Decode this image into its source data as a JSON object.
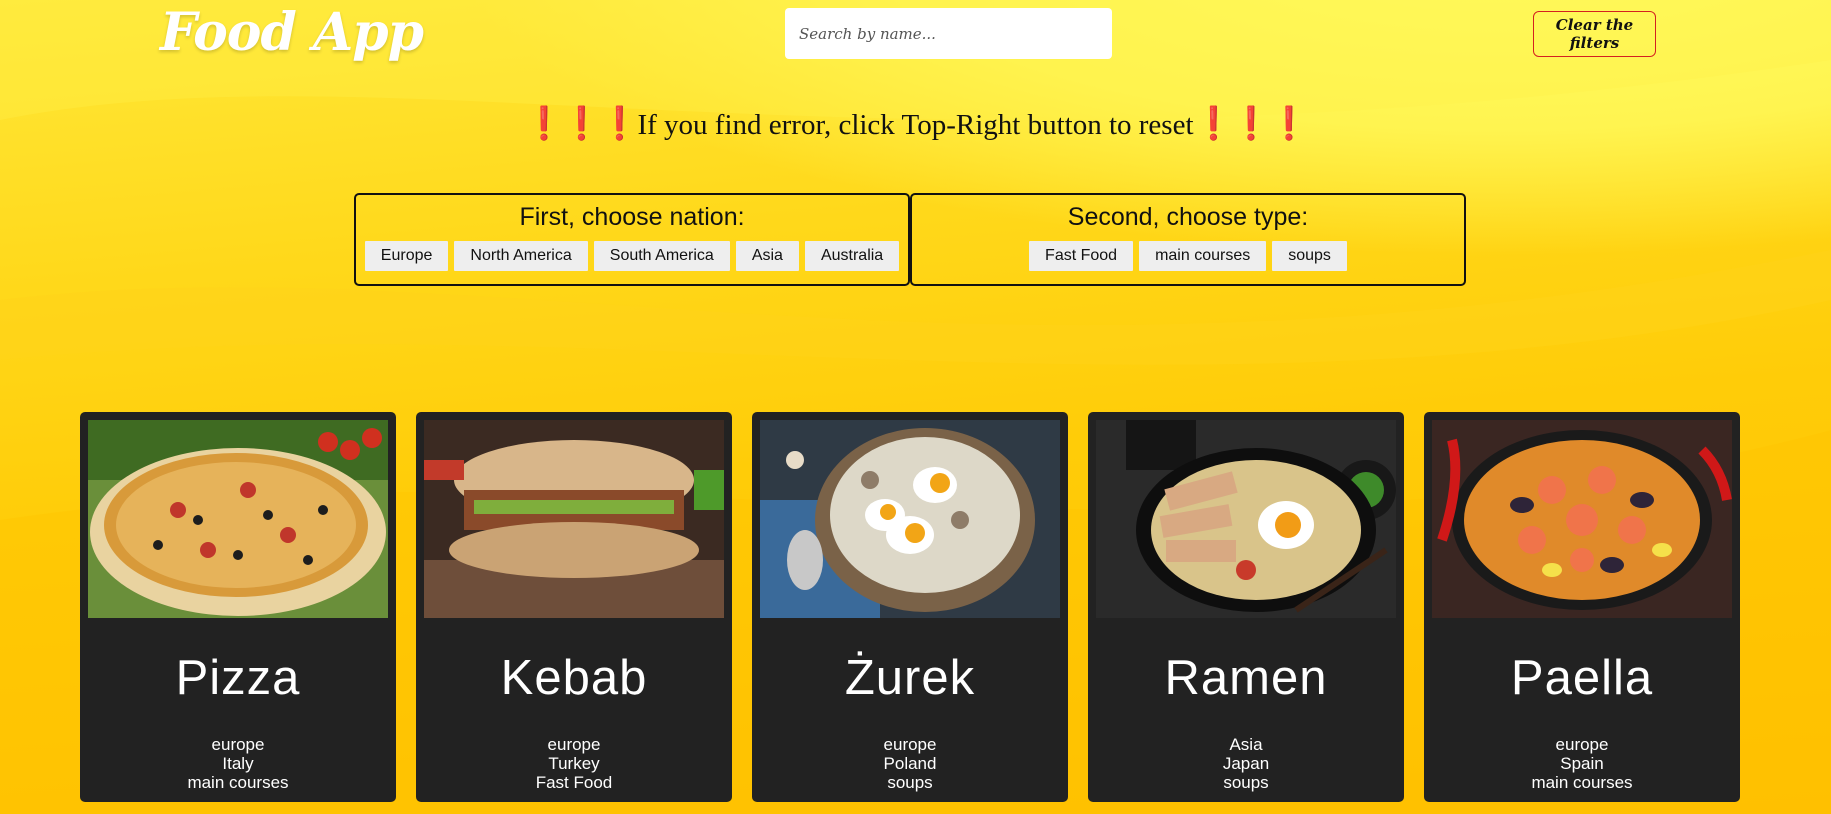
{
  "header": {
    "logo": "Food App",
    "search_placeholder": "Search by name...",
    "clear_label": "Clear the filters"
  },
  "warning": {
    "icon": "❗❗❗",
    "text": "If you find error, click Top-Right button to reset"
  },
  "filters": {
    "nation": {
      "title": "First, choose nation:",
      "options": [
        "Europe",
        "North America",
        "South America",
        "Asia",
        "Australia"
      ]
    },
    "type": {
      "title": "Second, choose type:",
      "options": [
        "Fast Food",
        "main courses",
        "soups"
      ]
    }
  },
  "dishes": [
    {
      "name": "Pizza",
      "region": "europe",
      "country": "Italy",
      "type": "main courses"
    },
    {
      "name": "Kebab",
      "region": "europe",
      "country": "Turkey",
      "type": "Fast Food"
    },
    {
      "name": "Żurek",
      "region": "europe",
      "country": "Poland",
      "type": "soups"
    },
    {
      "name": "Ramen",
      "region": "Asia",
      "country": "Japan",
      "type": "soups"
    },
    {
      "name": "Paella",
      "region": "europe",
      "country": "Spain",
      "type": "main courses"
    }
  ],
  "colors": {
    "background": "#ffcc08",
    "card": "#222222",
    "clear_border": "#d42020"
  }
}
